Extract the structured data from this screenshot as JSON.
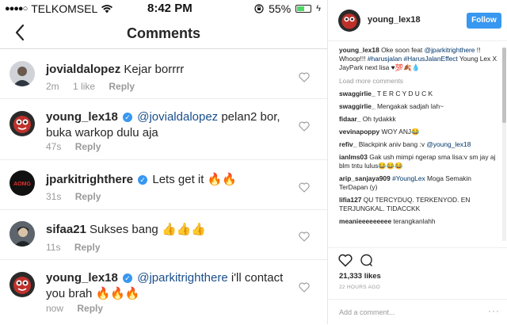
{
  "status": {
    "carrier": "TELKOMSEL",
    "time": "8:42 PM",
    "battery": "55%",
    "battery_level": 0.55
  },
  "nav": {
    "title": "Comments"
  },
  "comments": [
    {
      "user": "jovialdalopez",
      "verified": false,
      "mention": "",
      "text": "Kejar borrrr",
      "age": "2m",
      "likes": "1 like",
      "reply": "Reply"
    },
    {
      "user": "young_lex18",
      "verified": true,
      "mention": "@jovialdalopez",
      "text": " pelan2 bor, buka warkop dulu aja",
      "age": "47s",
      "likes": "",
      "reply": "Reply"
    },
    {
      "user": "jparkitrighthere",
      "verified": true,
      "mention": "",
      "text": "Lets get it 🔥🔥",
      "age": "31s",
      "likes": "",
      "reply": "Reply"
    },
    {
      "user": "sifaa21",
      "verified": false,
      "mention": "",
      "text": "Sukses bang 👍👍👍",
      "age": "11s",
      "likes": "",
      "reply": "Reply"
    },
    {
      "user": "young_lex18",
      "verified": true,
      "mention": "@jparkitrighthere",
      "text": " i'll contact you brah 🔥🔥🔥",
      "age": "now",
      "likes": "",
      "reply": "Reply"
    }
  ],
  "panel": {
    "username": "young_lex18",
    "follow_label": "Follow",
    "caption": {
      "user": "young_lex18",
      "part1": " Oke soon feat ",
      "mention": "@jparkitrighthere",
      "part2": " !! Whoop!!! ",
      "tags": "#harusjalan #HarusJalanEffect",
      "part3": " Young Lex X JayPark next lisa ♥💯🍂💧"
    },
    "load_more": "Load more comments",
    "comments": [
      {
        "user": "swaggirlie_",
        "text": "T E R C Y D U C K"
      },
      {
        "user": "swaggirlie_",
        "text": "Mengakak sadjah lah~"
      },
      {
        "user": "fidaar_",
        "text": "Oh tydakkk"
      },
      {
        "user": "vevinapoppy",
        "text": "WOY ANJ😂"
      },
      {
        "user": "refiv_",
        "text": "Blackpink aniv bang :v ",
        "mention": "@young_lex18"
      },
      {
        "user": "ianlms03",
        "text": "Gak ush mimpi ngerap sma lisa:v sm jay aj blm tntu lulus😂😂😂"
      },
      {
        "user": "arip_sanjaya909",
        "text": " Moga Semakin TerDapan (y)",
        "mention": "#YoungLex"
      },
      {
        "user": "lifia127",
        "text": "QU TERCYDUQ. TERKENYOD. EN TERJUNGKAL. TIDACCKK"
      },
      {
        "user": "meanieeeeeeeee",
        "text": "terangkanlahh"
      }
    ],
    "likes": "21,333 likes",
    "time": "22 HOURS AGO",
    "add_comment_placeholder": "Add a comment...",
    "more": "···"
  },
  "colors": {
    "accent": "#3897f0",
    "mention": "#1a4f8c",
    "muted": "#999999"
  }
}
